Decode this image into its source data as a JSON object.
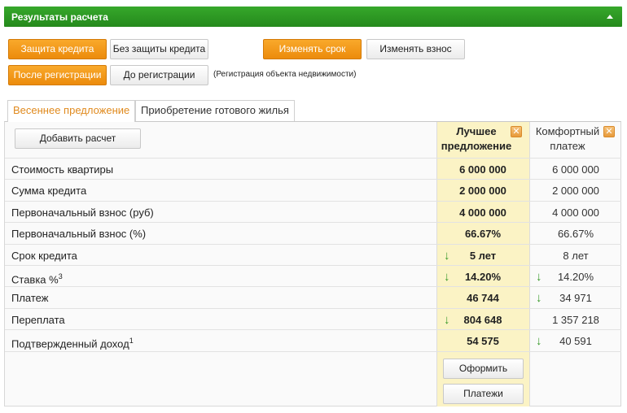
{
  "header": {
    "title": "Результаты расчета",
    "collapse_icon": "chevron-up-icon"
  },
  "options": {
    "protection": {
      "with": "Защита кредита",
      "without": "Без защиты кредита",
      "selected": "with"
    },
    "adjust": {
      "term": "Изменять срок",
      "payment": "Изменять взнос",
      "selected": "term"
    },
    "registration": {
      "after": "После регистрации",
      "before": "До регистрации",
      "selected": "after"
    },
    "note": "(Регистрация объекта недвижимости)"
  },
  "tabs": [
    {
      "label": "Весеннее предложение",
      "active": true
    },
    {
      "label": "Приобретение готового жилья",
      "active": false
    }
  ],
  "add_button": "Добавить расчет",
  "columns": {
    "best": {
      "title": "Лучшее предложение",
      "title_line1": "Лучшее",
      "title_line2": "предложение",
      "close_icon": "close-icon"
    },
    "comfort": {
      "title": "Комфортный платеж",
      "title_line1": "Комфортный",
      "title_line2": "платеж",
      "close_icon": "close-icon"
    }
  },
  "rows": [
    {
      "label": "Стоимость квартиры",
      "best": "6 000 000",
      "comfort": "6 000 000",
      "best_arrow": false,
      "comfort_arrow": false
    },
    {
      "label": "Сумма кредита",
      "best": "2 000 000",
      "comfort": "2 000 000",
      "best_arrow": false,
      "comfort_arrow": false
    },
    {
      "label": "Первоначальный взнос (руб)",
      "best": "4 000 000",
      "comfort": "4 000 000",
      "best_arrow": false,
      "comfort_arrow": false
    },
    {
      "label": "Первоначальный взнос (%)",
      "best": "66.67%",
      "comfort": "66.67%",
      "best_arrow": false,
      "comfort_arrow": false
    },
    {
      "label": "Срок кредита",
      "best": "5 лет",
      "comfort": "8 лет",
      "best_arrow": true,
      "comfort_arrow": false
    },
    {
      "label": "Ставка %",
      "sup": "3",
      "best": "14.20%",
      "comfort": "14.20%",
      "best_arrow": true,
      "comfort_arrow": true
    },
    {
      "label": "Платеж",
      "best": "46 744",
      "comfort": "34 971",
      "best_arrow": false,
      "comfort_arrow": true
    },
    {
      "label": "Переплата",
      "best": "804 648",
      "comfort": "1 357 218",
      "best_arrow": true,
      "comfort_arrow": false
    },
    {
      "label": "Подтвержденный доход",
      "sup": "1",
      "best": "54 575",
      "comfort": "40 591",
      "best_arrow": false,
      "comfort_arrow": true
    }
  ],
  "actions": {
    "apply": "Оформить",
    "payments": "Платежи"
  },
  "arrow_glyph": "↓",
  "close_glyph": "✕",
  "colors": {
    "header_green": "#2e9a24",
    "accent_orange": "#ec8b0c",
    "highlight_column": "#fbf3c5",
    "arrow_green": "#3a9a2b"
  }
}
